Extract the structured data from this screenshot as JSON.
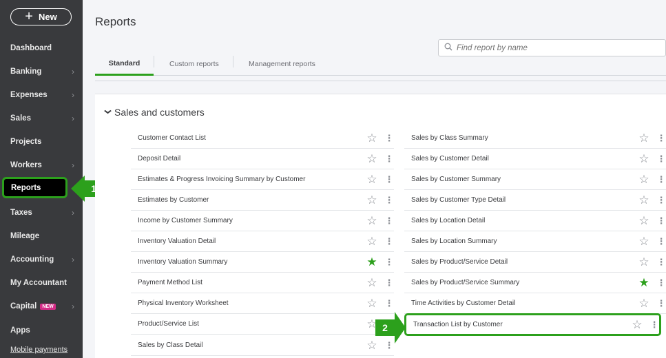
{
  "sidebar": {
    "new_label": "New",
    "items": [
      {
        "label": "Dashboard"
      },
      {
        "label": "Banking",
        "has_chevron": true
      },
      {
        "label": "Expenses",
        "has_chevron": true
      },
      {
        "label": "Sales",
        "has_chevron": true
      },
      {
        "label": "Projects"
      },
      {
        "label": "Workers",
        "has_chevron": true
      },
      {
        "label": "Reports",
        "active": true
      },
      {
        "label": "Taxes",
        "has_chevron": true
      },
      {
        "label": "Mileage"
      },
      {
        "label": "Accounting",
        "has_chevron": true
      },
      {
        "label": "My Accountant"
      },
      {
        "label": "Capital",
        "badge": "NEW",
        "has_chevron": true
      },
      {
        "label": "Apps"
      },
      {
        "label": "Mobile payments"
      }
    ]
  },
  "header": {
    "title": "Reports",
    "search_placeholder": "Find report by name"
  },
  "tabs": [
    {
      "label": "Standard",
      "active": true
    },
    {
      "label": "Custom reports"
    },
    {
      "label": "Management reports"
    }
  ],
  "section": {
    "title": "Sales and customers",
    "left_reports": [
      {
        "label": "Customer Contact List",
        "favorite": false
      },
      {
        "label": "Deposit Detail",
        "favorite": false
      },
      {
        "label": "Estimates & Progress Invoicing Summary by Customer",
        "favorite": false
      },
      {
        "label": "Estimates by Customer",
        "favorite": false
      },
      {
        "label": "Income by Customer Summary",
        "favorite": false
      },
      {
        "label": "Inventory Valuation Detail",
        "favorite": false
      },
      {
        "label": "Inventory Valuation Summary",
        "favorite": true
      },
      {
        "label": "Payment Method List",
        "favorite": false
      },
      {
        "label": "Physical Inventory Worksheet",
        "favorite": false
      },
      {
        "label": "Product/Service List",
        "favorite": false
      },
      {
        "label": "Sales by Class Detail",
        "favorite": false
      }
    ],
    "right_reports": [
      {
        "label": "Sales by Class Summary",
        "favorite": false
      },
      {
        "label": "Sales by Customer Detail",
        "favorite": false
      },
      {
        "label": "Sales by Customer Summary",
        "favorite": false
      },
      {
        "label": "Sales by Customer Type Detail",
        "favorite": false
      },
      {
        "label": "Sales by Location Detail",
        "favorite": false
      },
      {
        "label": "Sales by Location Summary",
        "favorite": false
      },
      {
        "label": "Sales by Product/Service Detail",
        "favorite": false
      },
      {
        "label": "Sales by Product/Service Summary",
        "favorite": true
      },
      {
        "label": "Time Activities by Customer Detail",
        "favorite": false
      },
      {
        "label": "Transaction List by Customer",
        "favorite": false,
        "highlighted": true
      }
    ]
  },
  "callouts": [
    {
      "label": "1"
    },
    {
      "label": "2"
    }
  ],
  "colors": {
    "sidebar_bg": "#393a3d",
    "accent_green": "#2ca01c",
    "new_badge": "#d52b87"
  },
  "icons": {
    "star_empty": "☆",
    "star_filled": "★",
    "kebab": "⋮",
    "chevron_right": "›",
    "chevron_down": "⌄",
    "search": "⚲",
    "plus": "+"
  }
}
